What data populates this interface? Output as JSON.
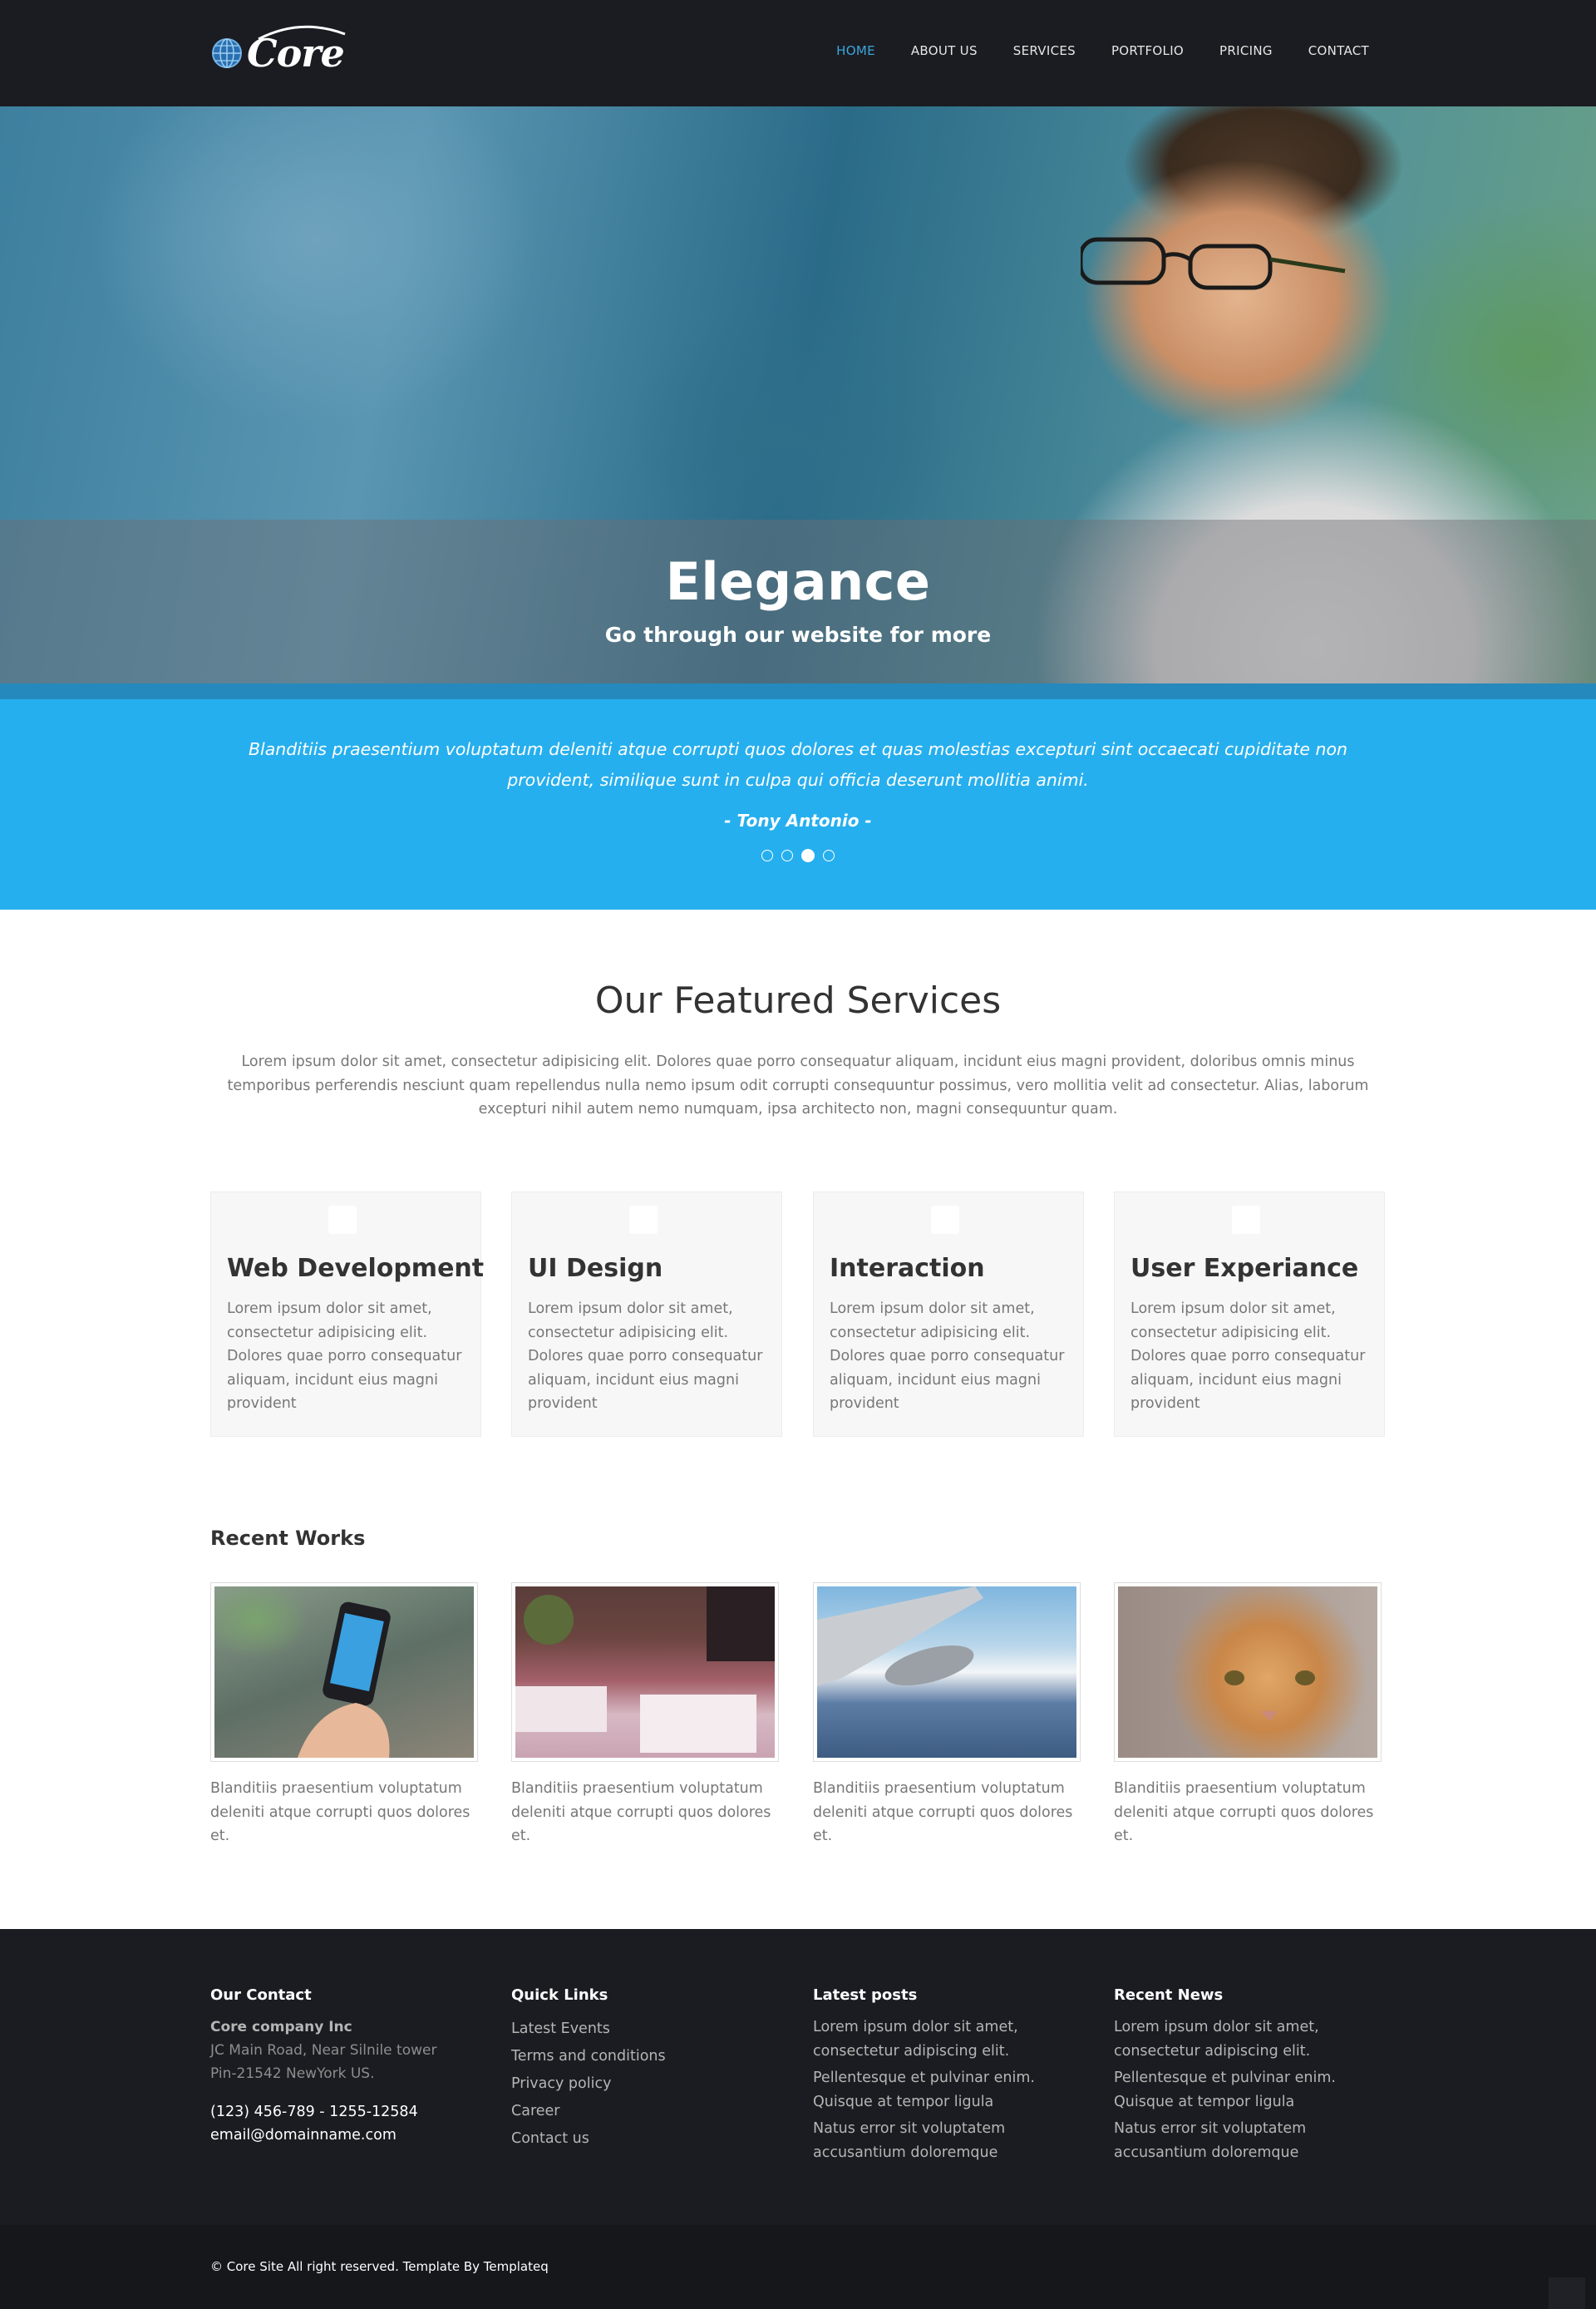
{
  "brand": {
    "name": "Core"
  },
  "nav": {
    "items": [
      {
        "label": "HOME",
        "active": true
      },
      {
        "label": "ABOUT US",
        "active": false
      },
      {
        "label": "SERVICES",
        "active": false
      },
      {
        "label": "PORTFOLIO",
        "active": false
      },
      {
        "label": "PRICING",
        "active": false
      },
      {
        "label": "CONTACT",
        "active": false
      }
    ]
  },
  "hero": {
    "title": "Elegance",
    "subtitle": "Go through our website for more"
  },
  "testimonial": {
    "quote": "Blanditiis praesentium voluptatum deleniti atque corrupti quos dolores et quas molestias excepturi sint occaecati cupiditate non provident, similique sunt in culpa qui officia deserunt mollitia animi.",
    "author": "- Tony Antonio -",
    "active_slide": 3,
    "slide_count": 4
  },
  "services": {
    "title": "Our Featured Services",
    "description": "Lorem ipsum dolor sit amet, consectetur adipisicing elit. Dolores quae porro consequatur aliquam, incidunt eius magni provident, doloribus omnis minus temporibus perferendis nesciunt quam repellendus nulla nemo ipsum odit corrupti consequuntur possimus, vero mollitia velit ad consectetur. Alias, laborum excepturi nihil autem nemo numquam, ipsa architecto non, magni consequuntur quam.",
    "cards": [
      {
        "title": "Web Development",
        "text": "Lorem ipsum dolor sit amet, consectetur adipisicing elit. Dolores quae porro consequatur aliquam, incidunt eius magni provident"
      },
      {
        "title": "UI Design",
        "text": "Lorem ipsum dolor sit amet, consectetur adipisicing elit. Dolores quae porro consequatur aliquam, incidunt eius magni provident"
      },
      {
        "title": "Interaction",
        "text": "Lorem ipsum dolor sit amet, consectetur adipisicing elit. Dolores quae porro consequatur aliquam, incidunt eius magni provident"
      },
      {
        "title": "User Experiance",
        "text": "Lorem ipsum dolor sit amet, consectetur adipisicing elit. Dolores quae porro consequatur aliquam, incidunt eius magni provident"
      }
    ]
  },
  "works": {
    "title": "Recent Works",
    "items": [
      {
        "image": "phone-in-hand-photo",
        "caption": "Blanditiis praesentium voluptatum deleniti atque corrupti quos dolores et."
      },
      {
        "image": "cafe-tables-photo",
        "caption": "Blanditiis praesentium voluptatum deleniti atque corrupti quos dolores et."
      },
      {
        "image": "airplane-wing-photo",
        "caption": "Blanditiis praesentium voluptatum deleniti atque corrupti quos dolores et."
      },
      {
        "image": "cat-photo",
        "caption": "Blanditiis praesentium voluptatum deleniti atque corrupti quos dolores et."
      }
    ]
  },
  "footer": {
    "contact": {
      "heading": "Our Contact",
      "company": "Core company Inc",
      "address1": "JC Main Road, Near Silnile tower",
      "address2": "Pin-21542 NewYork US.",
      "phone": "(123) 456-789 - 1255-12584",
      "email": "email@domainname.com"
    },
    "quick_links": {
      "heading": "Quick Links",
      "links": [
        "Latest Events",
        "Terms and conditions",
        "Privacy policy",
        "Career",
        "Contact us"
      ]
    },
    "latest_posts": {
      "heading": "Latest posts",
      "posts": [
        "Lorem ipsum dolor sit amet, consectetur adipiscing elit.",
        "Pellentesque et pulvinar enim. Quisque at tempor ligula",
        "Natus error sit voluptatem accusantium doloremque"
      ]
    },
    "recent_news": {
      "heading": "Recent News",
      "posts": [
        "Lorem ipsum dolor sit amet, consectetur adipiscing elit.",
        "Pellentesque et pulvinar enim. Quisque at tempor ligula",
        "Natus error sit voluptatem accusantium doloremque"
      ]
    },
    "copyright": "© Core Site All right reserved. Template By Templateq"
  },
  "colors": {
    "nav_bg": "#1b1c21",
    "accent": "#3ba6dd",
    "testimonial_bg": "#26afee",
    "footer_bg": "#1b1c21"
  }
}
